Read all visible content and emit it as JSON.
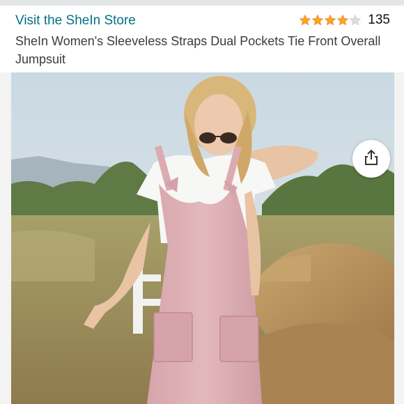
{
  "header": {
    "store_link": "Visit the SheIn Store",
    "rating_value": 4,
    "rating_max": 5,
    "rating_count": "135",
    "title": "SheIn Women's Sleeveless Straps Dual Pockets Tie Front Overall Jumpsuit"
  },
  "colors": {
    "link": "#007185",
    "star_filled": "#ffa41c",
    "star_empty": "#dddddd"
  },
  "icons": {
    "share": "share-icon",
    "star": "star-icon"
  }
}
